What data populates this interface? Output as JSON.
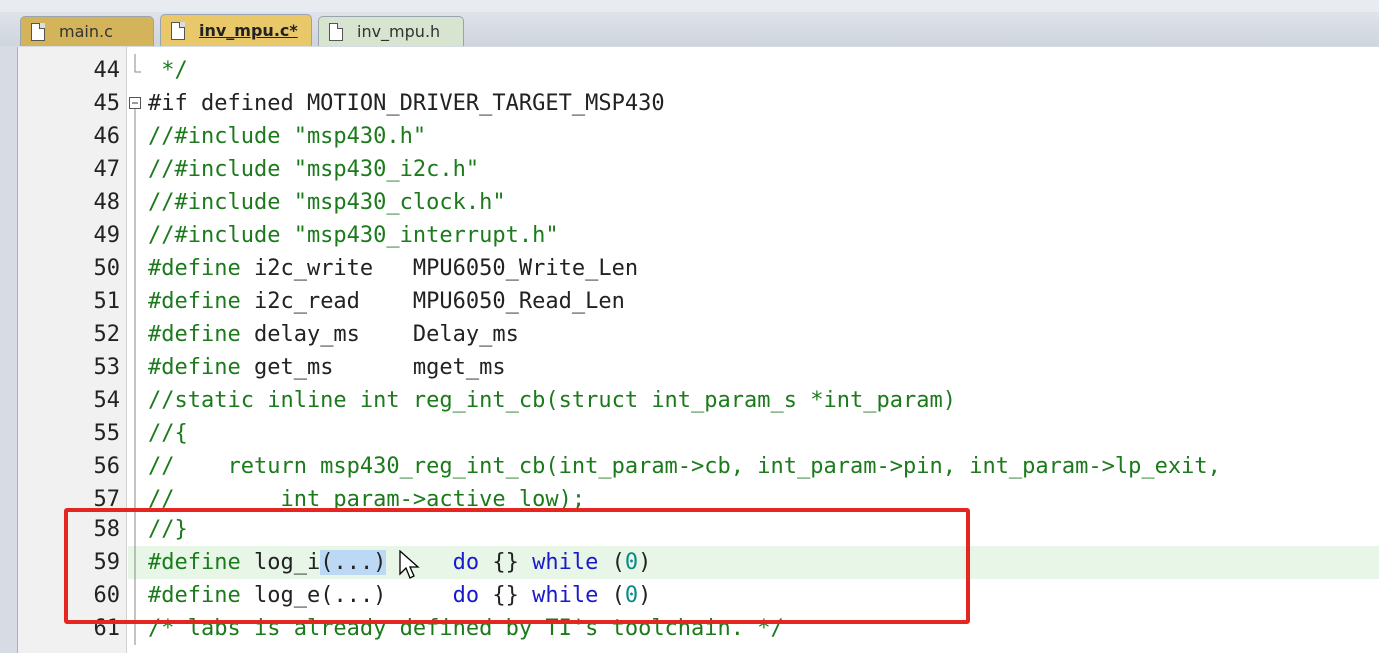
{
  "tabs": [
    {
      "label": "main.c"
    },
    {
      "label": "inv_mpu.c*"
    },
    {
      "label": "inv_mpu.h"
    }
  ],
  "lines": [
    {
      "num": "44",
      "code": " */"
    },
    {
      "num": "45",
      "code": "#if defined MOTION_DRIVER_TARGET_MSP430"
    },
    {
      "num": "46",
      "code": "//#include \"msp430.h\""
    },
    {
      "num": "47",
      "code": "//#include \"msp430_i2c.h\""
    },
    {
      "num": "48",
      "code": "//#include \"msp430_clock.h\""
    },
    {
      "num": "49",
      "code": "//#include \"msp430_interrupt.h\""
    },
    {
      "num": "50",
      "kw": "#define",
      "rest": " i2c_write   MPU6050_Write_Len"
    },
    {
      "num": "51",
      "kw": "#define",
      "rest": " i2c_read    MPU6050_Read_Len"
    },
    {
      "num": "52",
      "kw": "#define",
      "rest": " delay_ms    Delay_ms"
    },
    {
      "num": "53",
      "kw": "#define",
      "rest": " get_ms      mget_ms"
    },
    {
      "num": "54",
      "code": "//static inline int reg_int_cb(struct int_param_s *int_param)"
    },
    {
      "num": "55",
      "code": "//{"
    },
    {
      "num": "56",
      "code": "//    return msp430_reg_int_cb(int_param->cb, int_param->pin, int_param->lp_exit,"
    },
    {
      "num": "57",
      "code": "//        int_param->active_low);"
    },
    {
      "num": "58",
      "code": "//}"
    },
    {
      "num": "59",
      "kw": "#define",
      "name": " log_i",
      "sel": "(...)",
      "gap": "     ",
      "do": "do",
      "braces": " {} ",
      "while": "while",
      "paren_open": " (",
      "zero": "0",
      "paren_close": ")"
    },
    {
      "num": "60",
      "kw": "#define",
      "name": " log_e",
      "args": "(...)",
      "gap": "     ",
      "do": "do",
      "braces": " {} ",
      "while": "while",
      "paren_open": " (",
      "zero": "0",
      "paren_close": ")"
    },
    {
      "num": "61",
      "code": "/* labs is already defined by TI's toolchain. */"
    }
  ]
}
